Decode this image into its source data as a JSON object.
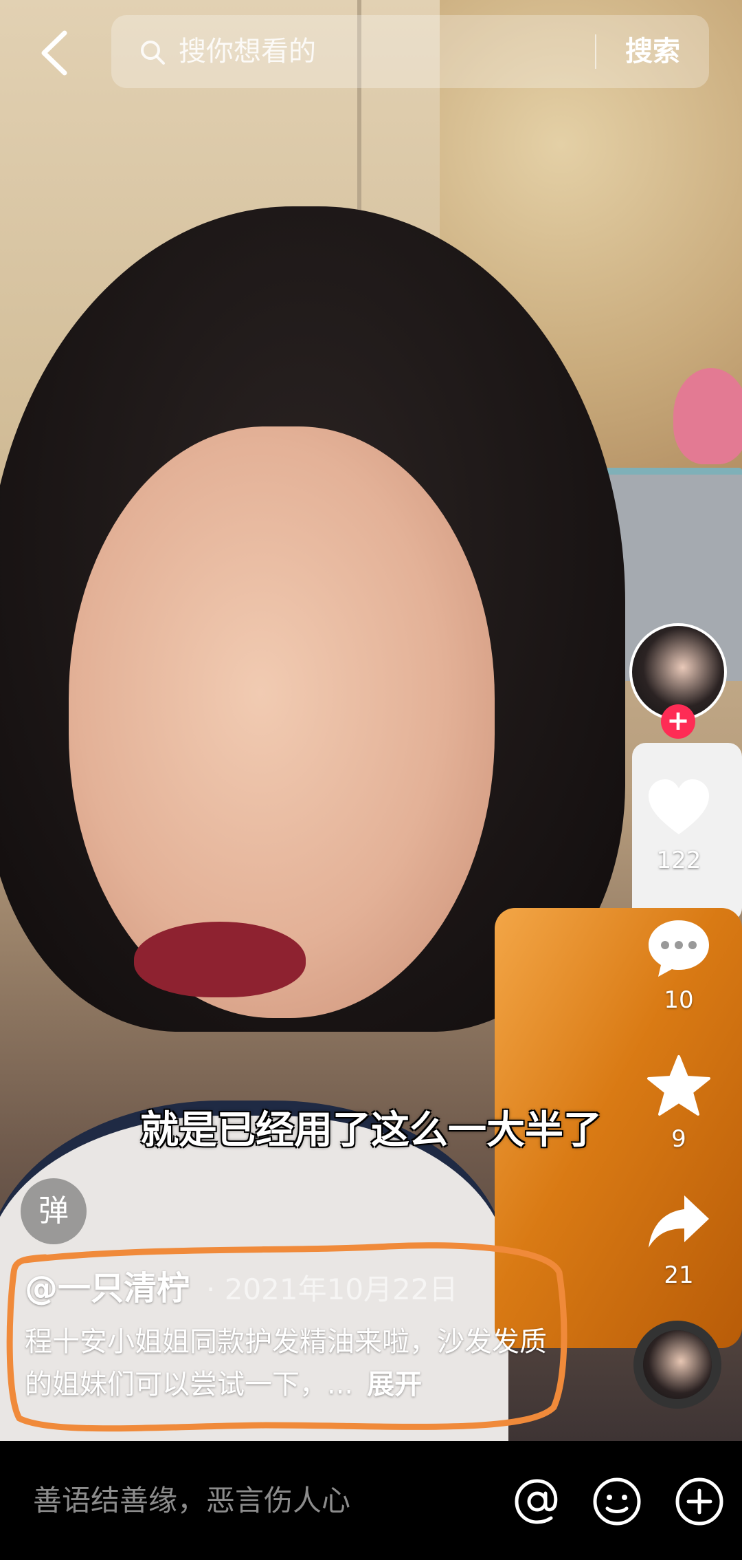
{
  "search": {
    "placeholder": "搜你想看的",
    "button_label": "搜索"
  },
  "video": {
    "subtitle": "就是已经用了这么一大半了"
  },
  "rail": {
    "likes": "122",
    "comments": "10",
    "favorites": "9",
    "shares": "21"
  },
  "danmu": {
    "label": "弹"
  },
  "post": {
    "author": "@一只清柠",
    "date": "· 2021年10月22日",
    "description": "程十安小姐姐同款护发精油来啦，沙发发质的姐妹们可以尝试一下，...",
    "expand_label": "展开"
  },
  "comment_bar": {
    "placeholder": "善语结善缘，恶言伤人心"
  },
  "colors": {
    "follow_accent": "#fe2c55",
    "annotation": "#f08a3a"
  },
  "icons": [
    "back-arrow-icon",
    "search-icon",
    "heart-icon",
    "comment-icon",
    "star-icon",
    "share-icon",
    "at-icon",
    "emoji-icon",
    "plus-icon"
  ]
}
